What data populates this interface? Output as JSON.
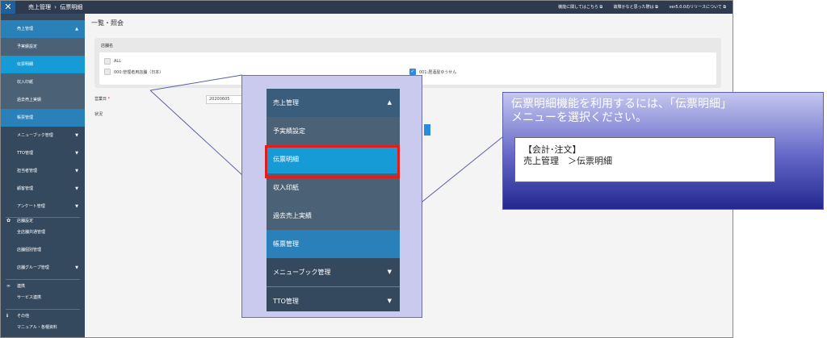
{
  "topbar": {
    "close_glyph": "✕",
    "crumb_root": "売上管理",
    "crumb_sep": "›",
    "crumb_page": "伝票明細",
    "link_manual": "機能に関してはこちら",
    "link_trouble": "故障かなと思った際は",
    "link_release": "ver5.0.0のリリースについて"
  },
  "sidebar": {
    "sales": "売上管理",
    "budget": "予実績設定",
    "slip": "伝票明細",
    "stamp": "収入印紙",
    "past": "過去売上実績",
    "ledger": "帳票管理",
    "menubook": "メニューブック管理",
    "tto": "TTO管理",
    "staff": "担当者管理",
    "customer": "顧客管理",
    "survey": "アンケート管理",
    "store_settings": "店舗設定",
    "store_link": "全店舗共通管理",
    "store_info": "店舗個別管理",
    "store_group": "店舗グループ管理",
    "link": "連携",
    "service_link": "サービス連携",
    "other": "その他",
    "manual": "マニュアル・各種資料"
  },
  "main": {
    "title": "一覧・照会",
    "store_label": "店舗名",
    "opt_all": "ALL",
    "opt_main": "000:管理者用店舗（日本）",
    "opt_store": "001:居酒屋ゆうせん",
    "business_day_label": "営業日",
    "required_mark": "*",
    "business_day_value": "20200605",
    "status_label": "状況"
  },
  "zoom": {
    "sales": "売上管理",
    "budget": "予実績設定",
    "slip": "伝票明細",
    "stamp": "収入印紙",
    "past": "過去売上実績",
    "ledger": "帳票管理",
    "menubook": "メニューブック管理",
    "tto": "TTO管理",
    "caret_up": "▲",
    "caret_down": "▼"
  },
  "info": {
    "line1": "伝票明細機能を利用するには、「伝票明細」",
    "line2": "メニューを選択ください。",
    "box_line1": "【会計･注文】",
    "box_line2": "売上管理　＞伝票明細"
  }
}
